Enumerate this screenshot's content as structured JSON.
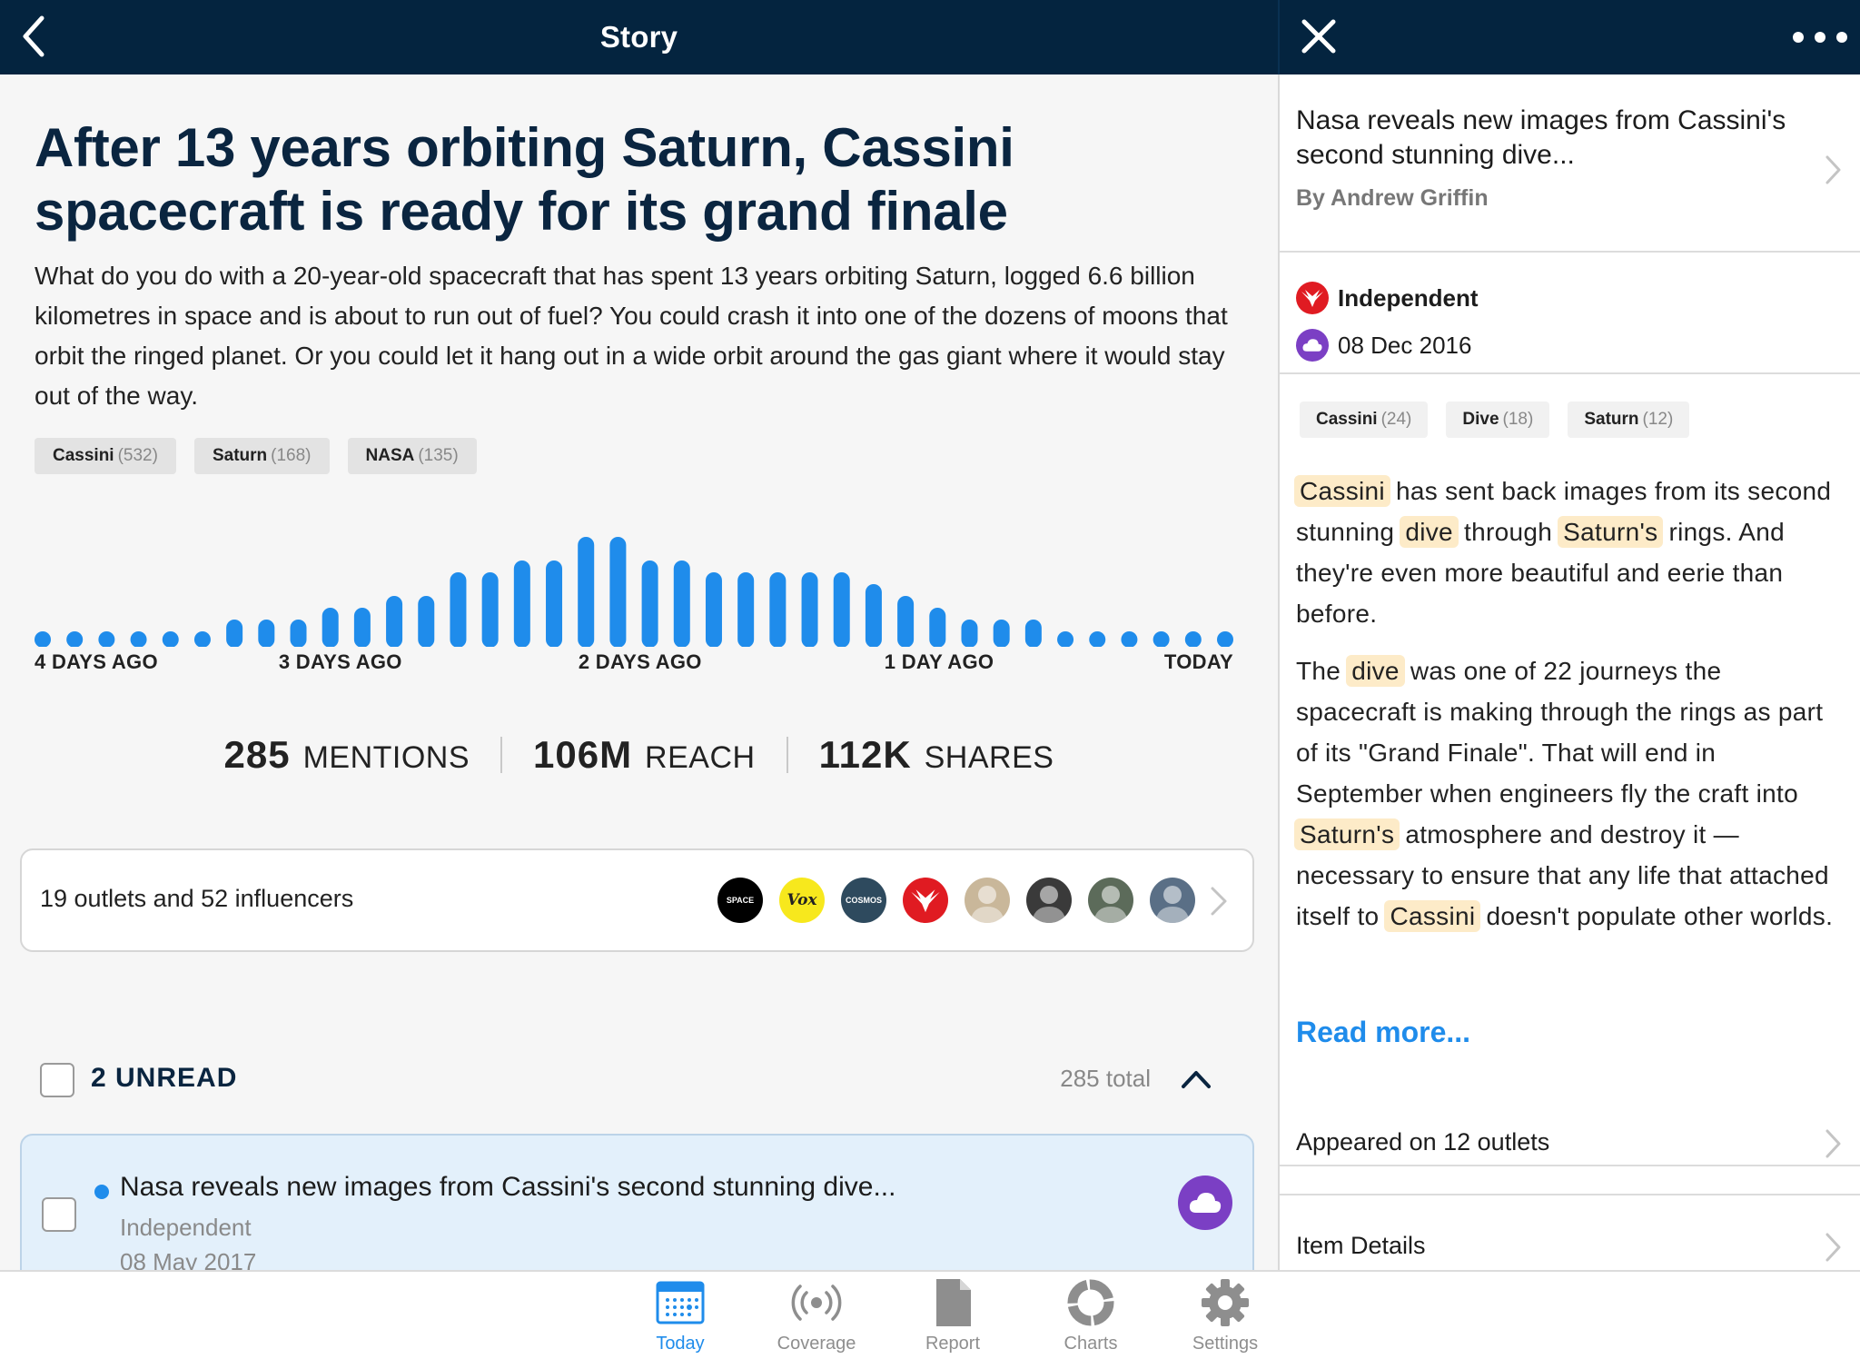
{
  "header": {
    "title": "Story"
  },
  "story": {
    "title": "After 13 years orbiting Saturn, Cassini spacecraft is ready for its grand finale",
    "summary": "What do you do with a 20-year-old spacecraft that has spent 13 years orbiting Saturn, logged 6.6 billion kilometres in space and is about to run out of fuel? You could crash it into one of the dozens of moons that orbit the ringed planet. Or you could let it hang out in a wide orbit around the gas giant where it would stay out of the way.",
    "tags": [
      {
        "name": "Cassini",
        "count": "(532)"
      },
      {
        "name": "Saturn",
        "count": "(168)"
      },
      {
        "name": "NASA",
        "count": "(135)"
      }
    ]
  },
  "chart_data": {
    "type": "bar",
    "title": "",
    "xlabel": "",
    "ylabel": "",
    "x_tick_labels": [
      "4 DAYS AGO",
      "3 DAYS AGO",
      "2 DAYS AGO",
      "1 DAY AGO",
      "TODAY"
    ],
    "values": [
      0,
      0,
      0,
      0,
      0,
      0,
      1,
      1,
      1,
      2,
      2,
      3,
      3,
      5,
      5,
      6,
      6,
      8,
      8,
      6,
      6,
      5,
      5,
      5,
      5,
      5,
      4,
      3,
      2,
      1,
      1,
      1,
      0,
      0,
      0,
      0,
      0,
      0
    ],
    "color": "#1f8ceb"
  },
  "stats": [
    {
      "value": "285",
      "label": "MENTIONS"
    },
    {
      "value": "106M",
      "label": "REACH"
    },
    {
      "value": "112K",
      "label": "SHARES"
    }
  ],
  "outlets": {
    "summary": "19 outlets and 52 influencers",
    "avatars": [
      {
        "name": "space-logo",
        "text": "SPACE",
        "bg": "#000000",
        "fg": "#ffffff"
      },
      {
        "name": "vox-logo",
        "text": "Vox",
        "bg": "#f7e81d",
        "fg": "#222222"
      },
      {
        "name": "cosmos-logo",
        "text": "COSMOS",
        "bg": "#2e4a5e",
        "fg": "#ffffff"
      },
      {
        "name": "independent-logo",
        "text": "",
        "bg": "#e01b22",
        "fg": "#ffffff"
      },
      {
        "name": "influencer-avatar-1",
        "text": "",
        "bg": "#c9b79a",
        "fg": "#ffffff"
      },
      {
        "name": "influencer-avatar-2",
        "text": "",
        "bg": "#3a3a3a",
        "fg": "#ffffff"
      },
      {
        "name": "influencer-avatar-3",
        "text": "",
        "bg": "#5c6b5a",
        "fg": "#ffffff"
      },
      {
        "name": "influencer-avatar-4",
        "text": "",
        "bg": "#5a6f86",
        "fg": "#ffffff"
      }
    ]
  },
  "unread": {
    "label": "2 UNREAD",
    "total": "285 total"
  },
  "article_item": {
    "title": "Nasa reveals new images from Cassini's second stunning dive...",
    "source": "Independent",
    "date": "08 May 2017"
  },
  "detail": {
    "title": "Nasa reveals new images from Cassini's second stunning dive...",
    "author": "By Andrew Griffin",
    "source": "Independent",
    "date": "08 Dec 2016",
    "tags": [
      {
        "name": "Cassini",
        "count": "(24)"
      },
      {
        "name": "Dive",
        "count": "(18)"
      },
      {
        "name": "Saturn",
        "count": "(12)"
      }
    ],
    "body": {
      "p1": {
        "w1": "Cassini",
        "t1": " has sent back images from its second stunning ",
        "w2": "dive",
        "t2": " through ",
        "w3": "Saturn's",
        "t3": " rings. And they're even more beautiful and eerie than before."
      },
      "p2": {
        "t0": "The ",
        "w1": "dive",
        "t1": " was one of 22 journeys the spacecraft is making through the rings as part of its \"Grand Finale\". That will end in September when engineers fly the craft into ",
        "w2": "Saturn's",
        "t2": " atmosphere and destroy it — necessary to ensure that any life that attached itself to ",
        "w3": "Cassini",
        "t3": " doesn't populate other worlds."
      }
    },
    "read_more": "Read more...",
    "appeared_on": "Appeared on 12 outlets",
    "item_details": "Item Details"
  },
  "tabs": [
    {
      "label": "Today",
      "icon": "calendar-icon",
      "active": true
    },
    {
      "label": "Coverage",
      "icon": "broadcast-icon",
      "active": false
    },
    {
      "label": "Report",
      "icon": "document-icon",
      "active": false
    },
    {
      "label": "Charts",
      "icon": "ring-chart-icon",
      "active": false
    },
    {
      "label": "Settings",
      "icon": "gear-icon",
      "active": false
    }
  ],
  "colors": {
    "navbar": "#04243f",
    "accent": "#1f8ceb",
    "highlight": "#fdebc8",
    "badge": "#7b3fc4",
    "independent_red": "#e01b22"
  }
}
